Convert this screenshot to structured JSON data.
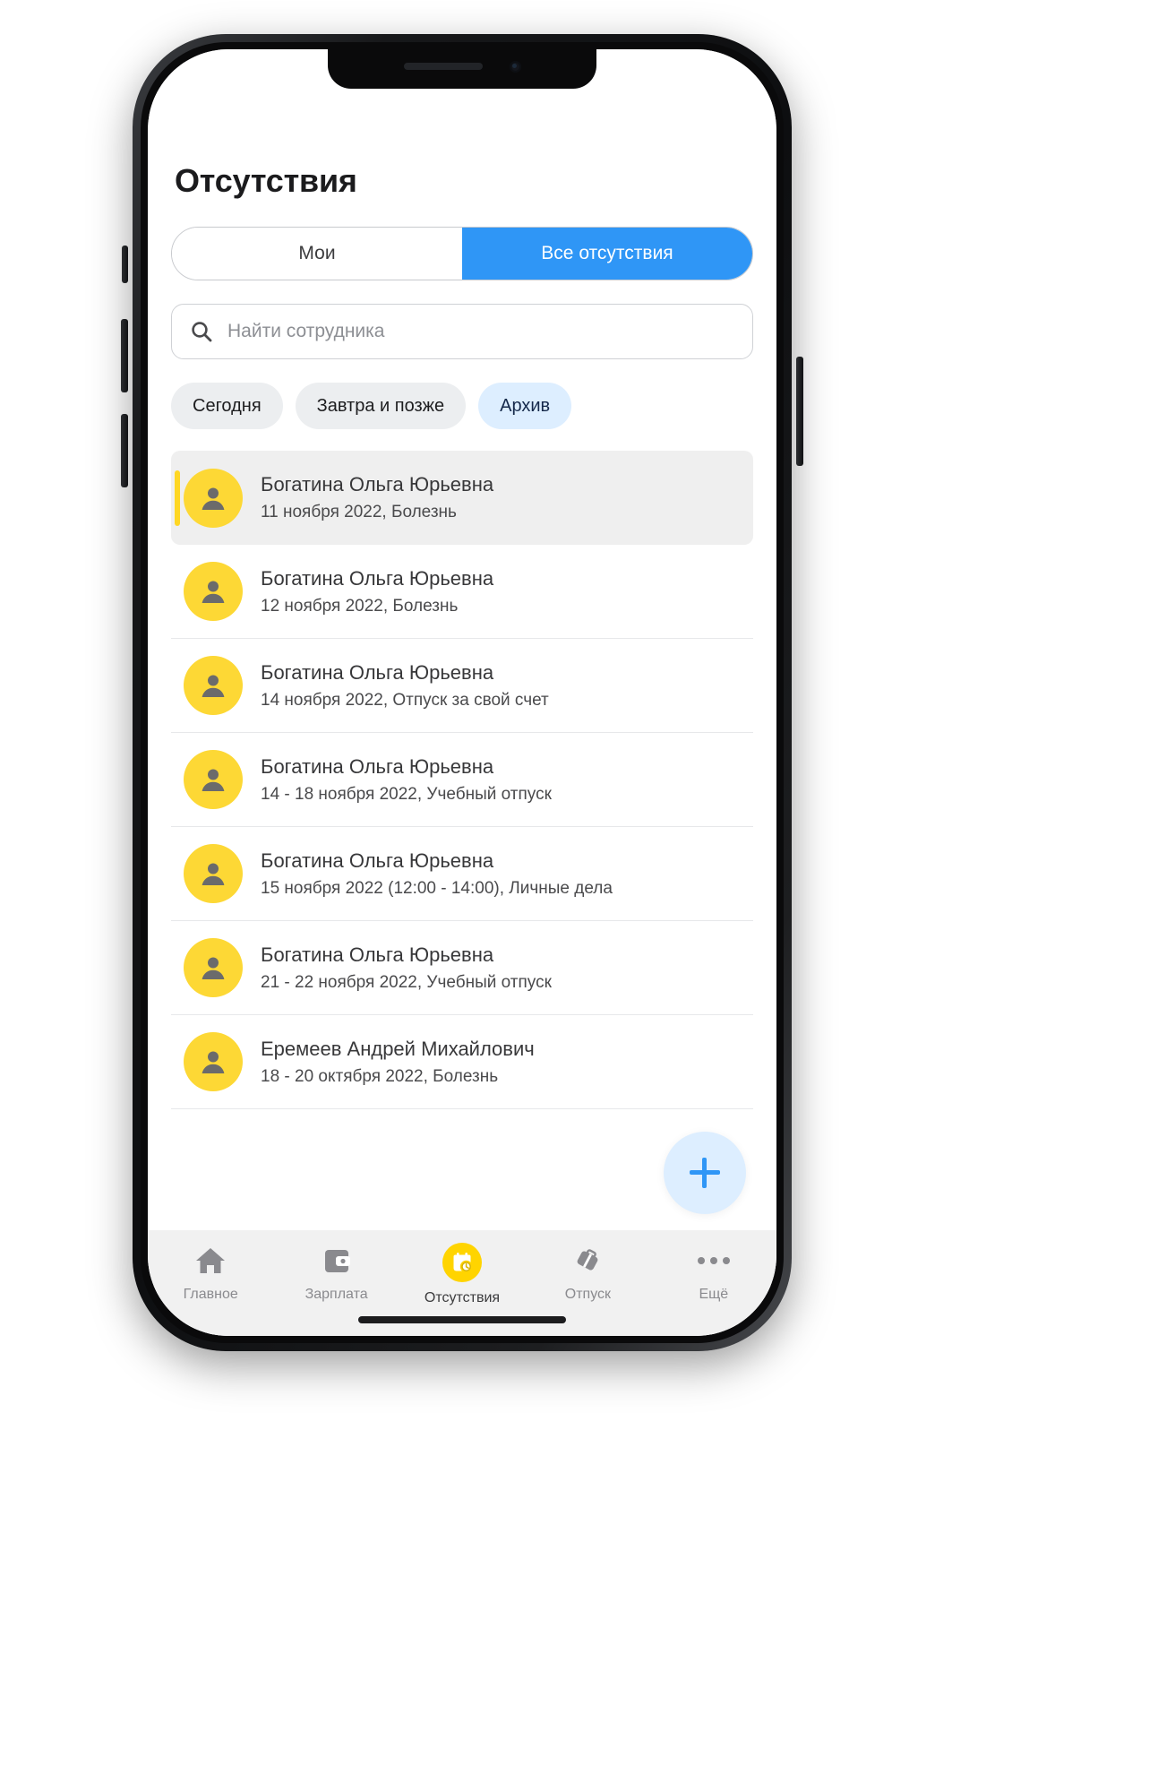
{
  "app": {
    "page_title": "Отсутствия"
  },
  "segmented": {
    "items": [
      {
        "label": "Мои",
        "active": false
      },
      {
        "label": "Все отсутствия",
        "active": true
      }
    ]
  },
  "search": {
    "placeholder": "Найти сотрудника",
    "value": "",
    "icon": "search-icon"
  },
  "chips": [
    {
      "label": "Сегодня",
      "selected": false
    },
    {
      "label": "Завтра и позже",
      "selected": false
    },
    {
      "label": "Архив",
      "selected": true
    }
  ],
  "list": {
    "rows": [
      {
        "name": "Богатина Ольга Юрьевна",
        "meta": "11 ноября 2022, Болезнь",
        "highlight": true
      },
      {
        "name": "Богатина Ольга Юрьевна",
        "meta": "12 ноября 2022, Болезнь",
        "highlight": false
      },
      {
        "name": "Богатина Ольга Юрьевна",
        "meta": "14 ноября 2022, Отпуск за свой счет",
        "highlight": false
      },
      {
        "name": "Богатина Ольга Юрьевна",
        "meta": "14 - 18 ноября 2022, Учебный отпуск",
        "highlight": false
      },
      {
        "name": "Богатина Ольга Юрьевна",
        "meta": "15 ноября 2022 (12:00 - 14:00), Личные дела",
        "highlight": false
      },
      {
        "name": "Богатина Ольга Юрьевна",
        "meta": "21 - 22 ноября 2022, Учебный отпуск",
        "highlight": false
      },
      {
        "name": "Еремеев Андрей Михайлович",
        "meta": "18 - 20 октября 2022, Болезнь",
        "highlight": false
      }
    ]
  },
  "fab": {
    "icon": "plus-icon",
    "label": "+"
  },
  "tabbar": {
    "items": [
      {
        "label": "Главное",
        "icon": "home-icon",
        "active": false
      },
      {
        "label": "Зарплата",
        "icon": "wallet-icon",
        "active": false
      },
      {
        "label": "Отсутствия",
        "icon": "calendar-clock-icon",
        "active": true
      },
      {
        "label": "Отпуск",
        "icon": "suitcase-icon",
        "active": false
      },
      {
        "label": "Ещё",
        "icon": "more-dots-icon",
        "active": false
      }
    ]
  },
  "colors": {
    "accent_blue": "#2f96f6",
    "chip_selected_bg": "#ddeeff",
    "avatar_yellow": "#fdd835",
    "tab_active_yellow": "#ffd400",
    "highlight_bar": "#ffd724"
  }
}
